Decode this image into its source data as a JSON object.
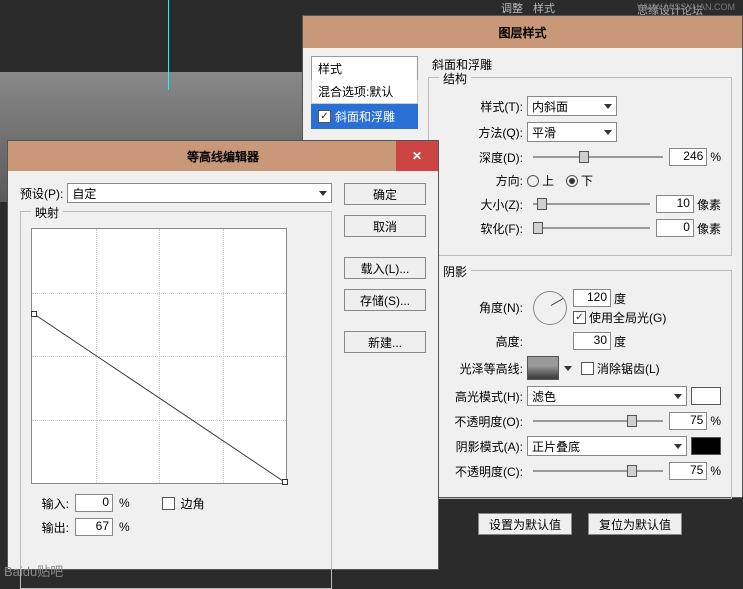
{
  "top": {
    "label1": "思缘设计论坛",
    "label2": "WWW.MISSYUAN.COM"
  },
  "adj_tab": "调整",
  "style_tab": "样式",
  "ls": {
    "title": "图层样式",
    "left": {
      "styles": "样式",
      "blend": "混合选项:默认",
      "bevel": "斜面和浮雕"
    },
    "panel_title": "斜面和浮雕",
    "structure": {
      "legend": "结构",
      "style_lbl": "样式(T):",
      "style_val": "内斜面",
      "tech_lbl": "方法(Q):",
      "tech_val": "平滑",
      "depth_lbl": "深度(D):",
      "depth_val": "246",
      "dir_lbl": "方向:",
      "up": "上",
      "down": "下",
      "size_lbl": "大小(Z):",
      "size_val": "10",
      "px": "像素",
      "soft_lbl": "软化(F):",
      "soft_val": "0"
    },
    "shading": {
      "legend": "阴影",
      "angle_lbl": "角度(N):",
      "angle_val": "120",
      "deg": "度",
      "global": "使用全局光(G)",
      "alt_lbl": "高度:",
      "alt_val": "30",
      "contour_lbl": "光泽等高线:",
      "anti": "消除锯齿(L)",
      "hl_lbl": "高光模式(H):",
      "hl_val": "滤色",
      "hl_op_lbl": "不透明度(O):",
      "hl_op_val": "75",
      "sh_lbl": "阴影模式(A):",
      "sh_val": "正片叠底",
      "sh_op_lbl": "不透明度(C):",
      "sh_op_val": "75"
    },
    "set_default": "设置为默认值",
    "reset_default": "复位为默认值",
    "pct": "%"
  },
  "ce": {
    "title": "等高线编辑器",
    "preset_lbl": "预设(P):",
    "preset_val": "自定",
    "ok": "确定",
    "cancel": "取消",
    "load": "载入(L)...",
    "save": "存储(S)...",
    "new": "新建...",
    "map": "映射",
    "input_lbl": "输入:",
    "input_val": "0",
    "output_lbl": "输出:",
    "output_val": "67",
    "corner": "边角",
    "pct": "%"
  },
  "watermark": "Baidu贴吧"
}
